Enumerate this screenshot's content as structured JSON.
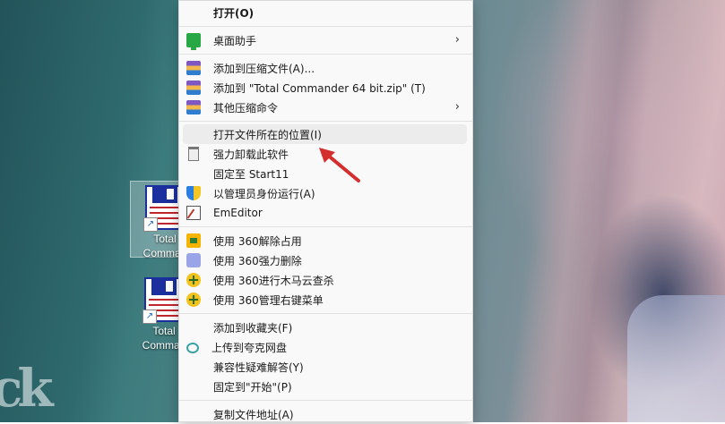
{
  "desktop": {
    "icons": [
      {
        "label_line1": "Total",
        "label_line2": "Comman",
        "selected": true
      },
      {
        "label_line1": "Total",
        "label_line2": "Comman",
        "selected": false
      }
    ]
  },
  "context_menu": {
    "items": [
      {
        "label": "打开(O)",
        "icon": "none",
        "bold": true
      },
      {
        "label": "桌面助手",
        "icon": "monitor-icon",
        "submenu": true
      },
      {
        "label": "添加到压缩文件(A)...",
        "icon": "winrar-icon"
      },
      {
        "label": "添加到 \"Total Commander 64 bit.zip\" (T)",
        "icon": "winrar-icon"
      },
      {
        "label": "其他压缩命令",
        "icon": "winrar-icon",
        "submenu": true
      },
      {
        "label": "打开文件所在的位置(I)",
        "icon": "none",
        "highlighted": true
      },
      {
        "label": "强力卸载此软件",
        "icon": "trash-icon"
      },
      {
        "label": "固定至 Start11",
        "icon": "none"
      },
      {
        "label": "以管理员身份运行(A)",
        "icon": "uac-shield-icon"
      },
      {
        "label": "EmEditor",
        "icon": "emeditor-icon"
      },
      {
        "label": "使用 360解除占用",
        "icon": "360-unlock-icon"
      },
      {
        "label": "使用 360强力删除",
        "icon": "360-shred-icon"
      },
      {
        "label": "使用 360进行木马云查杀",
        "icon": "360-scan-icon"
      },
      {
        "label": "使用 360管理右键菜单",
        "icon": "360-menu-icon"
      },
      {
        "label": "添加到收藏夹(F)",
        "icon": "none"
      },
      {
        "label": "上传到夸克网盘",
        "icon": "quark-cloud-icon"
      },
      {
        "label": "兼容性疑难解答(Y)",
        "icon": "none"
      },
      {
        "label": "固定到\"开始\"(P)",
        "icon": "none"
      },
      {
        "label": "复制文件地址(A)",
        "icon": "none"
      }
    ],
    "submenu_arrow": "›"
  },
  "colors": {
    "menu_background": "#f9f9f9",
    "hover_background": "#ececec",
    "annotation_arrow": "#d32f2f"
  }
}
